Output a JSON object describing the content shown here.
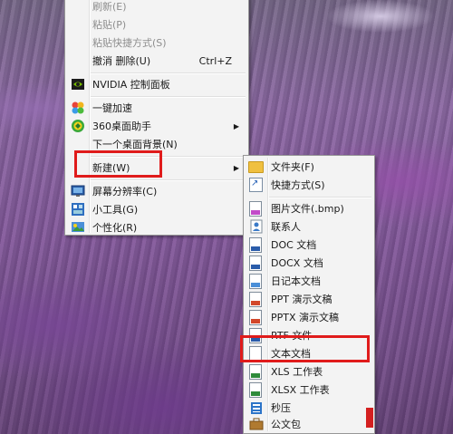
{
  "context_menu": {
    "partial_top_item": "刷新(E)",
    "items": [
      {
        "label": "粘贴(P)",
        "disabled": true
      },
      {
        "label": "粘贴快捷方式(S)",
        "disabled": true
      },
      {
        "label": "撤消 删除(U)",
        "shortcut": "Ctrl+Z"
      },
      {
        "label": "NVIDIA 控制面板",
        "icon": "nvidia-icon"
      },
      {
        "label": "一键加速",
        "icon": "accelerate-icon"
      },
      {
        "label": "360桌面助手",
        "icon": "360-desktop-icon",
        "has_submenu": true
      },
      {
        "label": "下一个桌面背景(N)"
      },
      {
        "label": "新建(W)",
        "has_submenu": true,
        "highlighted": true
      },
      {
        "label": "屏幕分辨率(C)",
        "icon": "screen-resolution-icon"
      },
      {
        "label": "小工具(G)",
        "icon": "gadgets-icon"
      },
      {
        "label": "个性化(R)",
        "icon": "personalize-icon"
      }
    ]
  },
  "new_submenu": {
    "items": [
      {
        "label": "文件夹(F)",
        "icon": "folder-icon"
      },
      {
        "label": "快捷方式(S)",
        "icon": "shortcut-icon"
      },
      {
        "label": "图片文件(.bmp)",
        "icon": "bmp-file-icon"
      },
      {
        "label": "联系人",
        "icon": "contact-icon"
      },
      {
        "label": "DOC 文档",
        "icon": "doc-file-icon"
      },
      {
        "label": "DOCX 文档",
        "icon": "docx-file-icon"
      },
      {
        "label": "日记本文档",
        "icon": "journal-file-icon"
      },
      {
        "label": "PPT 演示文稿",
        "icon": "ppt-file-icon"
      },
      {
        "label": "PPTX 演示文稿",
        "icon": "pptx-file-icon"
      },
      {
        "label": "RTF 文件",
        "icon": "rtf-file-icon"
      },
      {
        "label": "文本文档",
        "icon": "txt-file-icon",
        "highlighted": true
      },
      {
        "label": "XLS 工作表",
        "icon": "xls-file-icon"
      },
      {
        "label": "XLSX 工作表",
        "icon": "xlsx-file-icon"
      },
      {
        "label": "秒压",
        "icon": "compress-icon"
      },
      {
        "label": "公文包",
        "icon": "briefcase-icon"
      }
    ]
  },
  "colors": {
    "highlight_border": "#e01b1b",
    "menu_background": "#f3f3f3",
    "disabled_text": "#8d8d8d"
  }
}
